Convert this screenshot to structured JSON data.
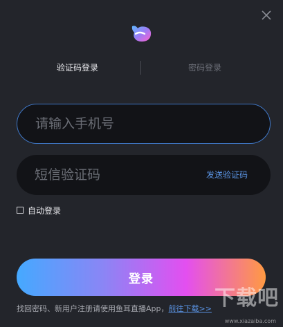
{
  "dialog": {
    "close_icon": "close-icon",
    "logo_icon": "fish-ear-logo-icon"
  },
  "tabs": {
    "sms_login": "验证码登录",
    "password_login": "密码登录",
    "active": "sms_login"
  },
  "phone_field": {
    "value": "",
    "placeholder": "请输入手机号"
  },
  "code_field": {
    "value": "",
    "placeholder": "短信验证码",
    "send_code_label": "发送验证码"
  },
  "auto_login": {
    "label": "自动登录",
    "checked": false
  },
  "login_button": {
    "label": "登录"
  },
  "footer": {
    "text": "找回密码、新用户注册请使用鱼耳直播App，",
    "link_label": "前往下载>>"
  },
  "watermark": {
    "main": "下载吧",
    "sub": "www.xiazaiba.com"
  },
  "colors": {
    "background": "#23252b",
    "field_bg": "#121317",
    "focus_border": "#3f77c6",
    "link": "#5b95e6",
    "gradient": [
      "#45a9ff",
      "#8b85f5",
      "#e34ff0",
      "#ff9a42"
    ]
  }
}
